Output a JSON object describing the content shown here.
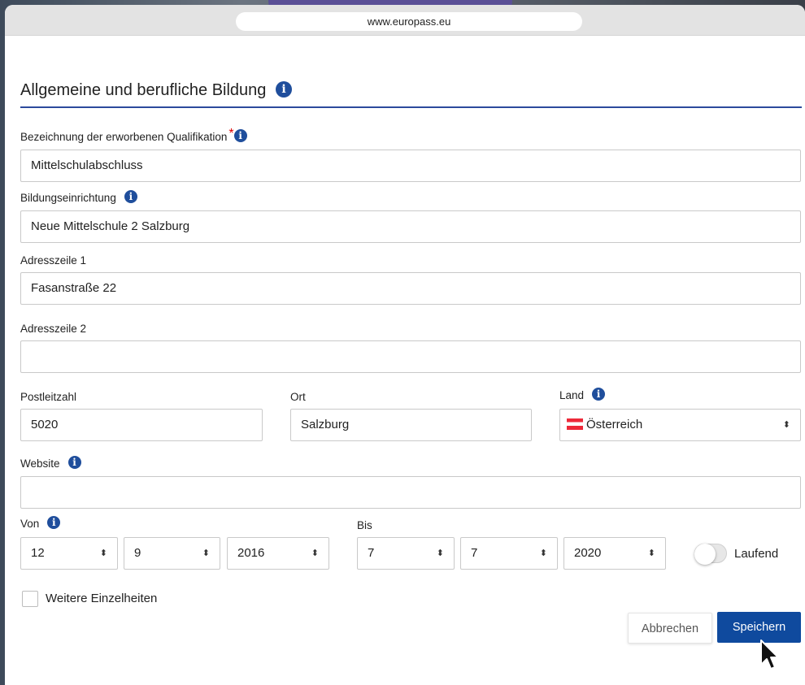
{
  "browser": {
    "url": "www.europass.eu"
  },
  "form": {
    "title": "Allgemeine und berufliche Bildung",
    "qualification": {
      "label": "Bezeichnung der erworbenen Qualifikation",
      "required": "*",
      "value": "Mittelschulabschluss"
    },
    "institution": {
      "label": "Bildungseinrichtung",
      "value": "Neue Mittelschule 2 Salzburg"
    },
    "address1": {
      "label": "Adresszeile 1",
      "value": "Fasanstraße 22"
    },
    "address2": {
      "label": "Adresszeile 2",
      "value": ""
    },
    "postcode": {
      "label": "Postleitzahl",
      "value": "5020"
    },
    "city": {
      "label": "Ort",
      "value": "Salzburg"
    },
    "country": {
      "label": "Land",
      "value": "Österreich"
    },
    "website": {
      "label": "Website",
      "value": ""
    },
    "from": {
      "label": "Von",
      "day": "12",
      "month": "9",
      "year": "2016"
    },
    "to": {
      "label": "Bis",
      "day": "7",
      "month": "7",
      "year": "2020"
    },
    "ongoing": {
      "label": "Laufend",
      "checked": false
    },
    "more_details": {
      "label": "Weitere Einzelheiten",
      "checked": false
    }
  },
  "actions": {
    "cancel": "Abbrechen",
    "save": "Speichern"
  },
  "icons": {
    "info": "i",
    "arrows": "⬍"
  },
  "colors": {
    "primary": "#0f4a9e",
    "info": "#1f4e9c",
    "required": "#dd0000"
  }
}
